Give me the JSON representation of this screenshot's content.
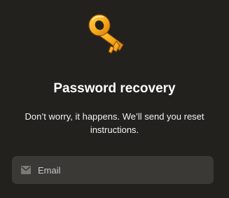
{
  "icon": {
    "name": "key-icon"
  },
  "title": "Password recovery",
  "description": "Don’t worry, it happens. We’ll send you reset instructions.",
  "email_field": {
    "icon": "mail-icon",
    "placeholder": "Email",
    "value": ""
  },
  "colors": {
    "background": "#23211e",
    "field_background": "#3a3936",
    "key_gold": "#f7a91c"
  }
}
